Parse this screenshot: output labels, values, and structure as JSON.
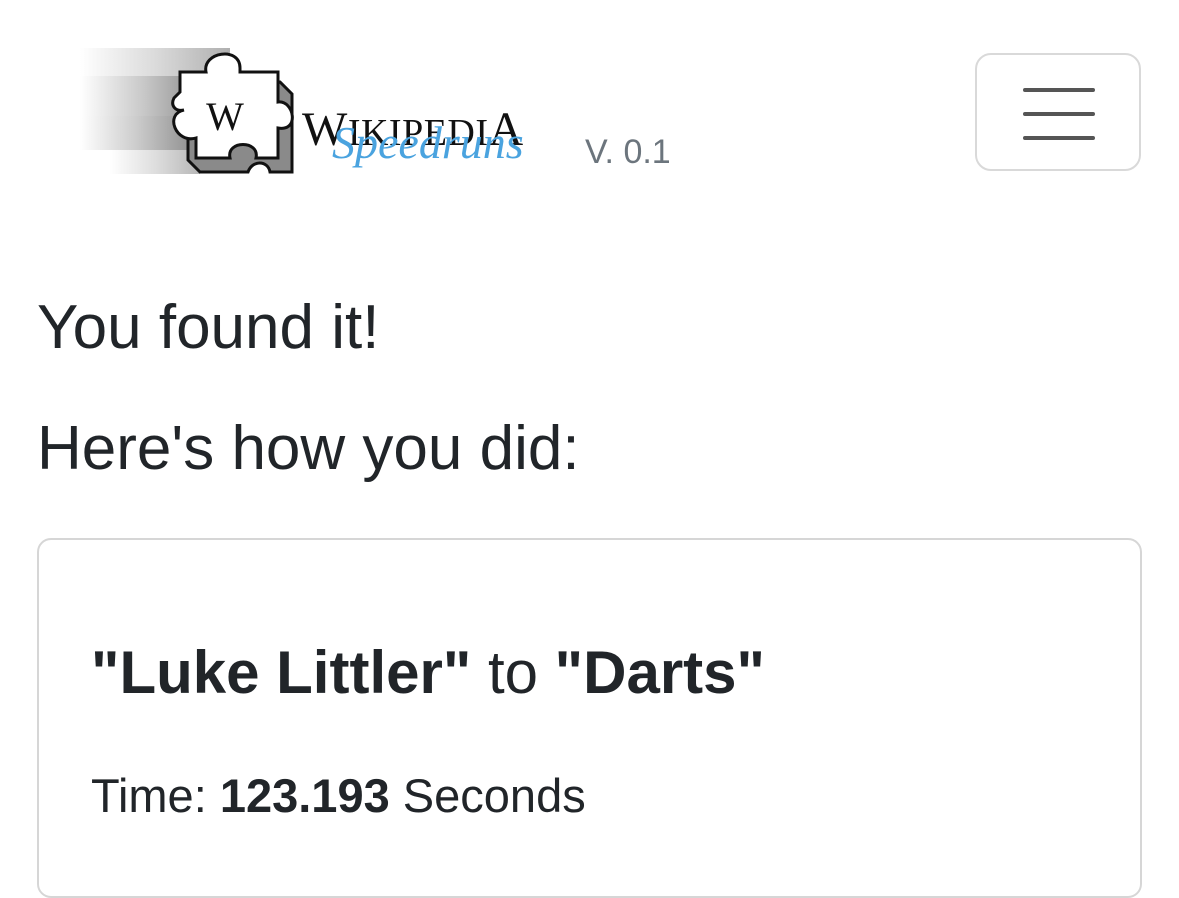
{
  "brand": {
    "title_first": "W",
    "title_rest": "IKIPEDI",
    "title_last": "A",
    "subtitle": "Speedruns",
    "version": "V. 0.1",
    "logo_letter": "W",
    "logo_icon": "puzzle-globe-icon",
    "accent_color": "#4aa3df"
  },
  "nav": {
    "menu_icon": "hamburger-menu-icon"
  },
  "main": {
    "found_heading": "You found it!",
    "how_heading": "Here's how you did:"
  },
  "result": {
    "start_article": "\"Luke Littler\"",
    "connector": "to",
    "end_article": "\"Darts\"",
    "time_label": "Time:",
    "time_value": "123.193",
    "time_unit": "Seconds"
  }
}
